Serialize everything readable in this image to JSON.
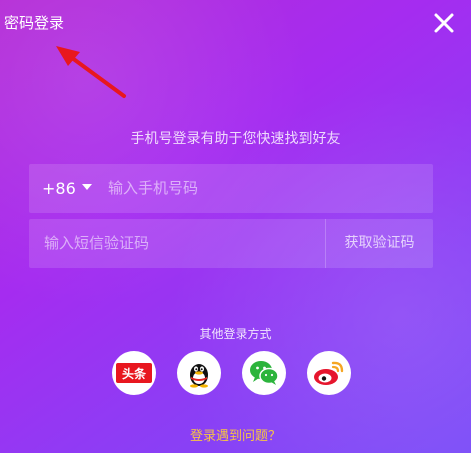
{
  "header": {
    "password_login_label": "密码登录",
    "close_icon": "close-icon"
  },
  "hint_text": "手机号登录有助于您快速找到好友",
  "phone": {
    "country_code": "+86",
    "placeholder": "输入手机号码"
  },
  "code": {
    "placeholder": "输入短信验证码",
    "get_code_label": "获取验证码"
  },
  "other_login": {
    "label": "其他登录方式",
    "providers": [
      {
        "icon": "toutiao-icon",
        "text": "头条"
      },
      {
        "icon": "qq-icon"
      },
      {
        "icon": "wechat-icon"
      },
      {
        "icon": "weibo-icon"
      }
    ]
  },
  "help_link": "登录遇到问题？",
  "colors": {
    "bg_start": "#b42ad6",
    "bg_end": "#7b4cf8",
    "accent_yellow": "#f6c445",
    "arrow_red": "#e8171f",
    "toutiao_red": "#e8171f",
    "wechat_green": "#2cb43c",
    "weibo_red": "#e6162d",
    "weibo_orange": "#f5a623"
  }
}
